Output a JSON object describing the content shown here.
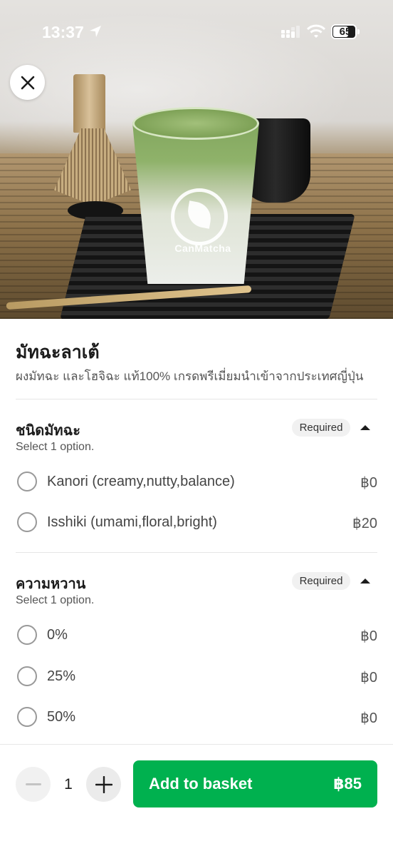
{
  "status_bar": {
    "time": "13:37",
    "battery": "65",
    "icons": [
      "location-arrow-icon",
      "signal-icon",
      "wifi-icon",
      "battery-icon"
    ]
  },
  "hero": {
    "logo_text": "CanMatcha",
    "close_icon": "close-icon"
  },
  "item": {
    "title": "มัทฉะลาเต้",
    "description": "ผงมัทฉะ และโฮจิฉะ แท้100% เกรดพรีเมี่ยมนำเข้าจากประเทศญี่ปุ่น"
  },
  "sections": [
    {
      "title": "ชนิดมัทฉะ",
      "badge": "Required",
      "subtitle": "Select 1 option.",
      "options": [
        {
          "label": "Kanori (creamy,nutty,balance)",
          "price": "฿0"
        },
        {
          "label": "Isshiki (umami,floral,bright)",
          "price": "฿20"
        }
      ]
    },
    {
      "title": "ความหวาน",
      "badge": "Required",
      "subtitle": "Select 1 option.",
      "options": [
        {
          "label": "0%",
          "price": "฿0"
        },
        {
          "label": "25%",
          "price": "฿0"
        },
        {
          "label": "50%",
          "price": "฿0"
        }
      ]
    }
  ],
  "bottom": {
    "quantity": "1",
    "add_label": "Add to basket",
    "total": "฿85"
  },
  "colors": {
    "accent": "#00b14f",
    "badge_bg": "#f1f1f1",
    "text": "#1c1c1c"
  }
}
